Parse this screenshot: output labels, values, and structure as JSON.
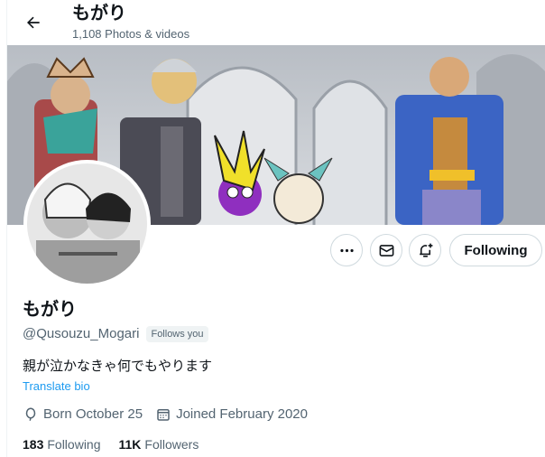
{
  "header": {
    "title": "もがり",
    "subtitle": "1,108 Photos & videos"
  },
  "profile": {
    "display_name": "もがり",
    "handle": "@Qusouzu_Mogari",
    "follows_you_badge": "Follows you",
    "bio": "親が泣かなきゃ何でもやります",
    "translate_label": "Translate bio",
    "birthday": "Born October 25",
    "joined": "Joined February 2020"
  },
  "actions": {
    "follow_label": "Following",
    "more_icon": "more-icon",
    "message_icon": "envelope-icon",
    "notification_icon": "bell-plus-icon"
  },
  "stats": {
    "following_count": "183",
    "following_label": "Following",
    "followers_count": "11K",
    "followers_label": "Followers"
  },
  "colors": {
    "link": "#1d9bf0",
    "secondary_text": "#536471",
    "border": "#cfd9de"
  }
}
